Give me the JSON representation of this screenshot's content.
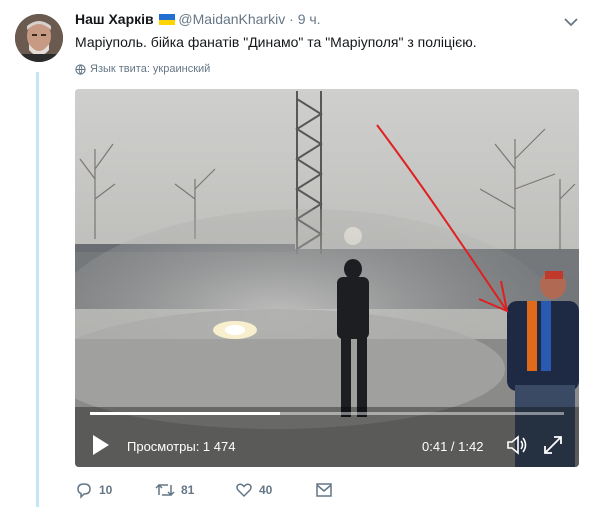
{
  "tweet": {
    "author_name": "Наш Харків",
    "handle": "@MaidanKharkiv",
    "separator": "·",
    "time": "9 ч.",
    "text": "Маріуполь. бійка фанатів \"Динамо\" та \"Маріуполя\" з поліцією.",
    "language_note": "Язык твита: украинский"
  },
  "video": {
    "views_label": "Просмотры: 1 474",
    "timecode": "0:41 / 1:42",
    "progress_fraction": 0.4
  },
  "actions": {
    "replies": "10",
    "retweets": "81",
    "likes": "40"
  },
  "icons": {
    "caret": "chevron-down-icon",
    "globe": "globe-icon",
    "play": "play-icon",
    "volume": "volume-icon",
    "fullscreen": "fullscreen-icon",
    "reply": "reply-icon",
    "retweet": "retweet-icon",
    "like": "heart-icon",
    "message": "message-icon"
  },
  "colors": {
    "link_blue": "#1da1f2",
    "muted": "#657786",
    "thread_line": "#c3e6f5",
    "arrow_red": "#e02020"
  }
}
